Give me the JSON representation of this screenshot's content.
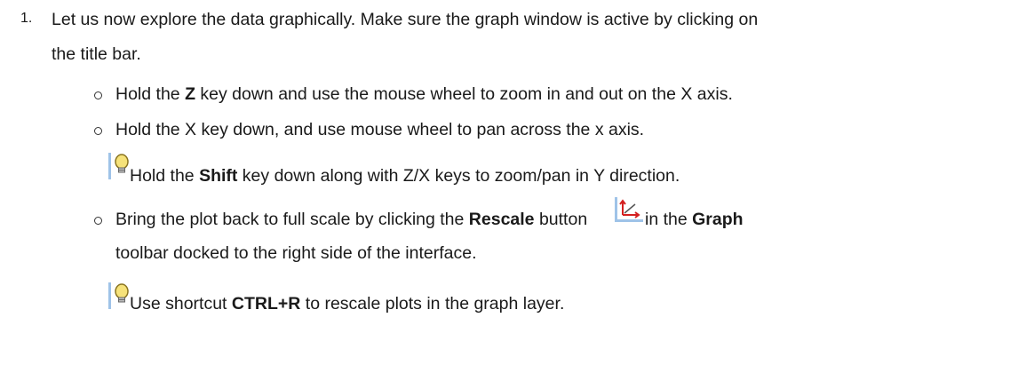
{
  "step": {
    "number": "1.",
    "line1": "Let us now explore the data graphically. Make sure the graph window is active by clicking on",
    "line2": "the title bar."
  },
  "items": [
    {
      "pre": "Hold the ",
      "bold": "Z",
      "post": " key down and use the mouse wheel to zoom in and out on the X axis."
    },
    {
      "text": "Hold the X key down, and use mouse wheel to pan across the x axis."
    }
  ],
  "tip1": {
    "pre": "Hold the ",
    "bold": "Shift",
    "post": " key down along with Z/X keys to zoom/pan in Y direction."
  },
  "item3": {
    "pre": "Bring the plot back to full scale by clicking the ",
    "bold1": "Rescale",
    "mid": " button ",
    "mid2": "in the ",
    "bold2": "Graph",
    "line2": "toolbar docked to the right side of the interface."
  },
  "tip2": {
    "pre": "Use shortcut ",
    "bold": "CTRL+R",
    "post": " to rescale plots in the graph layer."
  },
  "icons": {
    "tip": "lightbulb-icon",
    "rescale": "rescale-icon"
  }
}
